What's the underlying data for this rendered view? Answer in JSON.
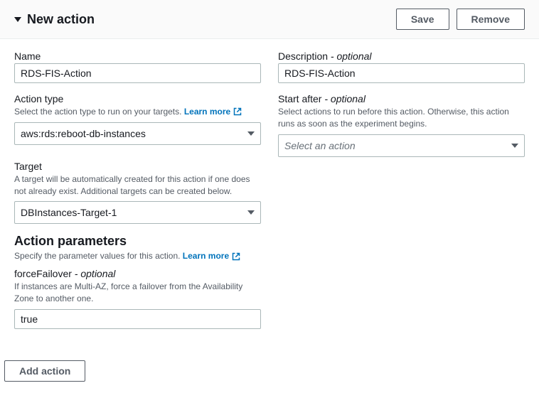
{
  "header": {
    "title": "New action",
    "save_label": "Save",
    "remove_label": "Remove"
  },
  "left": {
    "name_label": "Name",
    "name_value": "RDS-FIS-Action",
    "action_type_label": "Action type",
    "action_type_desc": "Select the action type to run on your targets. ",
    "learn_more": "Learn more",
    "action_type_value": "aws:rds:reboot-db-instances",
    "target_label": "Target",
    "target_desc": "A target will be automatically created for this action if one does not already exist. Additional targets can be created below.",
    "target_value": "DBInstances-Target-1",
    "params_heading": "Action parameters",
    "params_desc": "Specify the parameter values for this action. ",
    "force_failover_label": "forceFailover",
    "force_failover_optional": " - optional",
    "force_failover_desc": "If instances are Multi-AZ, force a failover from the Availability Zone to another one.",
    "force_failover_value": "true"
  },
  "right": {
    "description_label": "Description",
    "description_optional": " - optional",
    "description_value": "RDS-FIS-Action",
    "start_after_label": "Start after",
    "start_after_optional": " - optional",
    "start_after_desc": "Select actions to run before this action. Otherwise, this action runs as soon as the experiment begins.",
    "start_after_placeholder": "Select an action"
  },
  "footer": {
    "add_action_label": "Add action"
  }
}
